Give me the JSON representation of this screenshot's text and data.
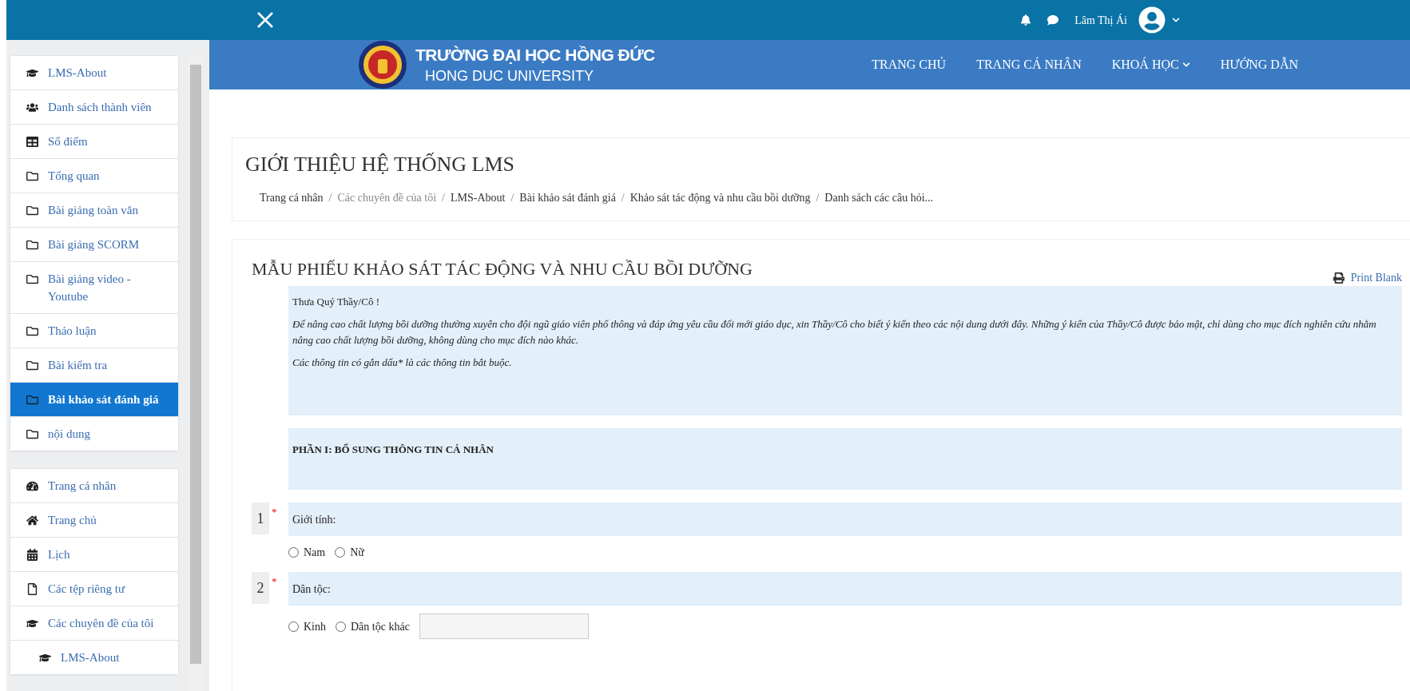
{
  "topbar": {
    "user_name": "Lâm Thị Ái"
  },
  "sidebar": {
    "groups": [
      {
        "items": [
          {
            "kind": "course",
            "label": "LMS-About",
            "selected": false
          },
          {
            "kind": "participants",
            "label": "Danh sách thành viên",
            "selected": false
          },
          {
            "kind": "grades",
            "label": "Sổ điểm",
            "selected": false
          },
          {
            "kind": "section",
            "label": "Tổng quan",
            "selected": false
          },
          {
            "kind": "section",
            "label": "Bài giảng toàn văn",
            "selected": false
          },
          {
            "kind": "section",
            "label": "Bài giảng SCORM",
            "selected": false
          },
          {
            "kind": "section",
            "label": "Bài giảng video - Youtube",
            "selected": false
          },
          {
            "kind": "section",
            "label": "Thảo luận",
            "selected": false
          },
          {
            "kind": "section",
            "label": "Bài kiểm tra",
            "selected": false
          },
          {
            "kind": "section",
            "label": "Bài khảo sát đánh giá",
            "selected": true
          },
          {
            "kind": "section",
            "label": "nội dung",
            "selected": false
          }
        ]
      },
      {
        "items": [
          {
            "kind": "dashboard",
            "label": "Trang cá nhân",
            "selected": false
          },
          {
            "kind": "home",
            "label": "Trang chủ",
            "selected": false
          },
          {
            "kind": "calendar",
            "label": "Lịch",
            "selected": false
          },
          {
            "kind": "files",
            "label": "Các tệp riêng tư",
            "selected": false
          },
          {
            "kind": "course",
            "label": "Các chuyên đề của tôi",
            "selected": false,
            "children": [
              {
                "kind": "course",
                "label": "LMS-About",
                "selected": false
              }
            ]
          }
        ]
      }
    ]
  },
  "banner": {
    "title": "TRƯỜNG ĐẠI HỌC HỒNG ĐỨC",
    "subtitle": "HONG DUC UNIVERSITY",
    "nav": [
      {
        "label": "TRANG CHỦ",
        "dropdown": false
      },
      {
        "label": "TRANG CÁ NHÂN",
        "dropdown": false
      },
      {
        "label": "KHOÁ HỌC",
        "dropdown": true
      },
      {
        "label": "HƯỚNG DẪN",
        "dropdown": false
      }
    ]
  },
  "page_header": {
    "title": "GIỚI THIỆU HỆ THỐNG LMS",
    "breadcrumb": [
      {
        "label": "Trang cá nhân",
        "link": true
      },
      {
        "separator": "/",
        "label": "Các chuyên đề của tôi",
        "link": false
      },
      {
        "separator": "/",
        "label": "LMS-About",
        "link": true
      },
      {
        "separator": "/",
        "label": "Bài khảo sát đánh giá",
        "link": true
      },
      {
        "separator": "/",
        "label": "Khảo sát tác động và nhu cầu bồi dưỡng",
        "link": true
      },
      {
        "separator": "/",
        "label": "Danh sách các câu hỏi...",
        "link": true
      }
    ]
  },
  "survey": {
    "title": "MẪU PHIẾU KHẢO SÁT TÁC ĐỘNG VÀ NHU CẦU BỒI DƯỠNG",
    "print_label": "Print Blank",
    "intro": {
      "greeting": "Thưa Quý Thầy/Cô !",
      "paragraph": "Để nâng cao chất lượng bồi dưỡng thường xuyên cho đội ngũ giáo viên phổ thông và đáp ứng yêu cầu đổi mới giáo dục, xin Thầy/Cô cho biết ý kiến theo các nội dung dưới đây. Những ý kiến của Thầy/Cô được bảo mật, chỉ dùng cho mục đích nghiên cứu nhằm nâng cao chất lượng bồi dưỡng, không dùng cho mục đích nào khác.",
      "note": "Các thông tin có gắn dấu* là các thông tin bắt buộc."
    },
    "section_title": "PHẦN I: BỔ SUNG THÔNG TIN CÁ NHÂN",
    "questions": [
      {
        "kind": "choice",
        "number": "1",
        "required_mark": "*",
        "label": "Giới tính:",
        "options": [
          {
            "label": "Nam",
            "selected": false
          },
          {
            "label": "Nữ",
            "selected": false
          }
        ]
      },
      {
        "kind": "choice_with_other",
        "number": "2",
        "required_mark": "*",
        "label": "Dân tộc:",
        "options": [
          {
            "label": "Kinh",
            "selected": false
          },
          {
            "label": "Dân tộc khác",
            "selected": false
          }
        ]
      }
    ]
  }
}
